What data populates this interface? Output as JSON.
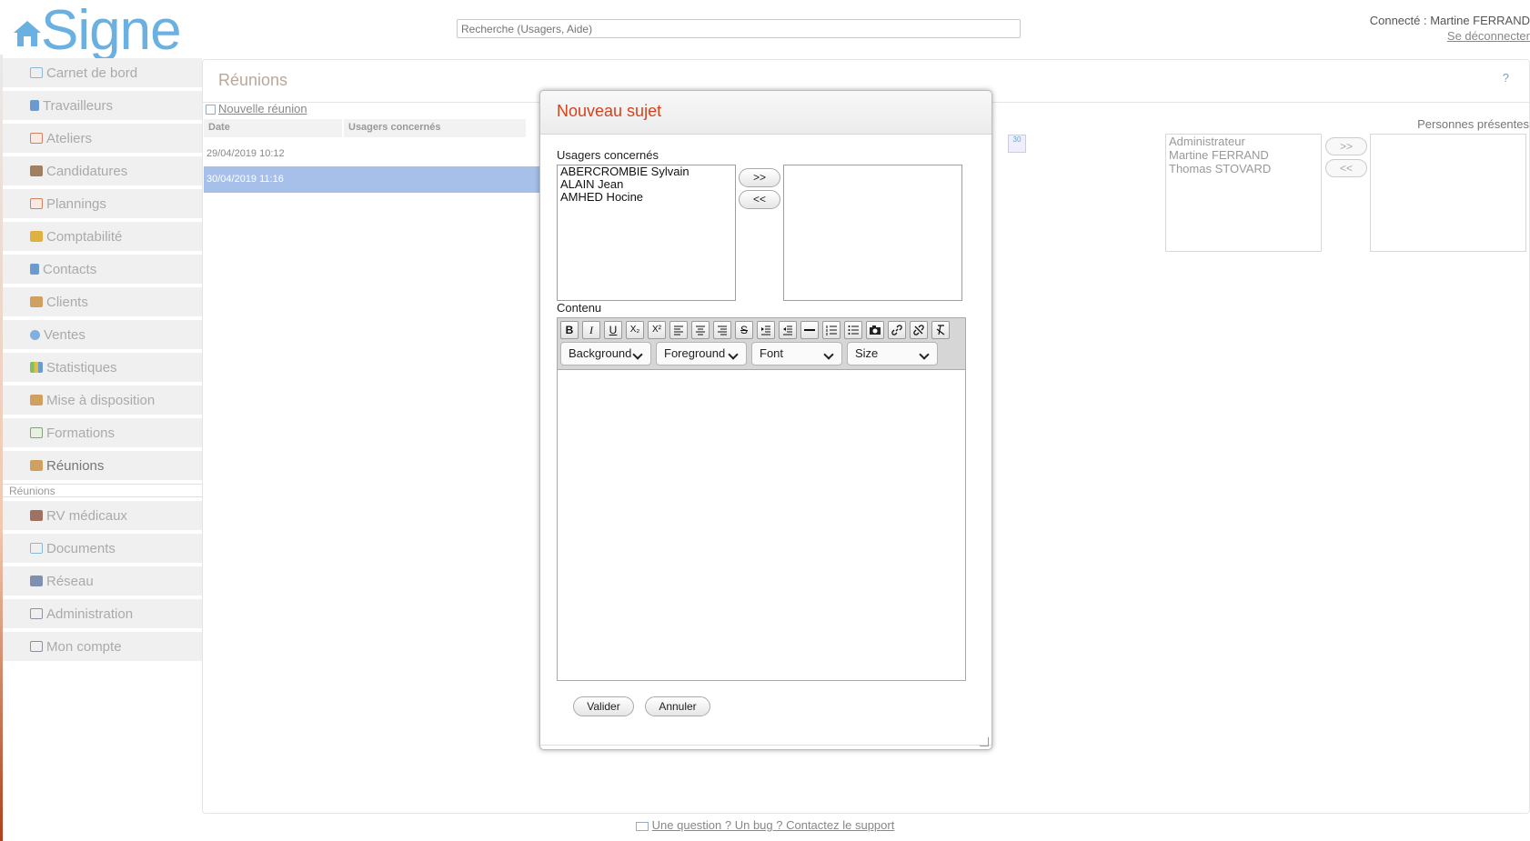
{
  "header": {
    "logo_text": "Signe",
    "search_placeholder": "Recherche (Usagers, Aide)",
    "connected": "Connecté : Martine FERRAND",
    "logout": "Se déconnecter"
  },
  "sidebar": {
    "items": [
      {
        "label": "Carnet de bord",
        "icon": "envelope-icon",
        "color": "#8ab8d8"
      },
      {
        "label": "Travailleurs",
        "icon": "people-icon",
        "color": "#6a9ad0"
      },
      {
        "label": "Ateliers",
        "icon": "calendar-icon",
        "color": "#d08060"
      },
      {
        "label": "Candidatures",
        "icon": "folder-icon",
        "color": "#a08060"
      },
      {
        "label": "Plannings",
        "icon": "calendar-icon",
        "color": "#d08060"
      },
      {
        "label": "Comptabilité",
        "icon": "coins-icon",
        "color": "#e0b040"
      },
      {
        "label": "Contacts",
        "icon": "people-icon",
        "color": "#6a9ad0"
      },
      {
        "label": "Clients",
        "icon": "handshake-icon",
        "color": "#d0a060"
      },
      {
        "label": "Ventes",
        "icon": "globe-icon",
        "color": "#80b0e0"
      },
      {
        "label": "Statistiques",
        "icon": "bar-chart-icon",
        "color": "#80c060"
      },
      {
        "label": "Mise à disposition",
        "icon": "house-icon",
        "color": "#d0a060"
      },
      {
        "label": "Formations",
        "icon": "board-icon",
        "color": "#80a080"
      },
      {
        "label": "Réunions",
        "icon": "meeting-icon",
        "color": "#d0a060"
      }
    ],
    "sub_label": "Réunions",
    "items_after": [
      {
        "label": "RV médicaux",
        "icon": "medical-icon",
        "color": "#a07060"
      },
      {
        "label": "Documents",
        "icon": "envelope-icon",
        "color": "#8ab8d8"
      },
      {
        "label": "Réseau",
        "icon": "network-icon",
        "color": "#8090b0"
      },
      {
        "label": "Administration",
        "icon": "settings-list-icon",
        "color": "#9090a0"
      },
      {
        "label": "Mon compte",
        "icon": "settings-list-icon",
        "color": "#9090a0"
      }
    ]
  },
  "main": {
    "title": "Réunions",
    "help": "?",
    "new_meeting": "Nouvelle réunion",
    "columns": [
      "Date",
      "Usagers concernés"
    ],
    "rows": [
      {
        "date": "29/04/2019 10:12"
      },
      {
        "date": "30/04/2019 11:16"
      }
    ],
    "presentes_label": "Personnes présentes",
    "available_people": [
      "Administrateur",
      "Martine FERRAND",
      "Thomas STOVARD"
    ],
    "btn_add": ">>",
    "btn_remove": "<<",
    "calendar_day": "30"
  },
  "modal": {
    "title": "Nouveau sujet",
    "usagers_label": "Usagers concernés",
    "usagers": [
      "ABERCROMBIE Sylvain",
      "ALAIN Jean",
      "AMHED Hocine"
    ],
    "btn_add": ">>",
    "btn_remove": "<<",
    "content_label": "Contenu",
    "toolbar": {
      "bold": "B",
      "italic": "I",
      "underline": "U",
      "subscript": "X₂",
      "superscript": "X²",
      "strike": "S"
    },
    "selects": [
      "Background",
      "Foreground",
      "Font",
      "Size"
    ],
    "validate": "Valider",
    "cancel": "Annuler"
  },
  "footer": {
    "support": "Une question ? Un bug ? Contactez le support"
  }
}
